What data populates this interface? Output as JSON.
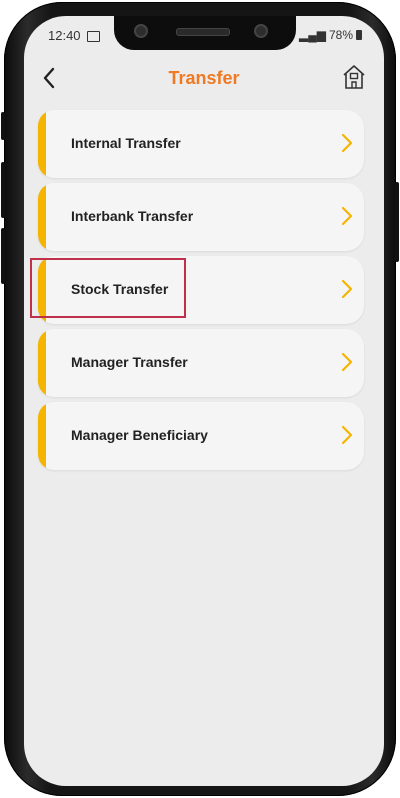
{
  "status_bar": {
    "time": "12:40",
    "battery": "78%"
  },
  "header": {
    "title": "Transfer",
    "back_icon": "back-chevron-icon",
    "home_icon": "home-icon"
  },
  "menu": {
    "accent_color": "#f4b400",
    "items": [
      {
        "label": "Internal Transfer"
      },
      {
        "label": "Interbank Transfer"
      },
      {
        "label": "Stock Transfer",
        "highlighted": true
      },
      {
        "label": "Manager Transfer"
      },
      {
        "label": "Manager Beneficiary"
      }
    ]
  },
  "colors": {
    "title": "#ef7a23",
    "highlight_border": "#c0304a",
    "background": "#ececec"
  }
}
